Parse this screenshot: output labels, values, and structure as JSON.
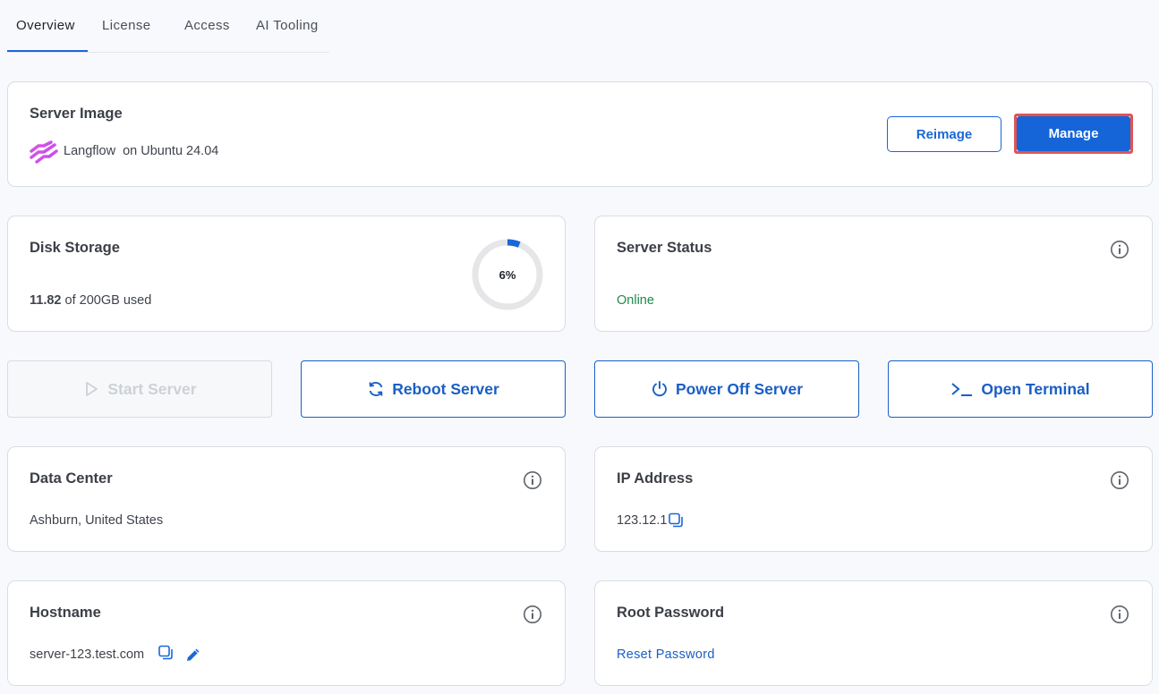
{
  "tabs": [
    {
      "label": "Overview",
      "active": true
    },
    {
      "label": "License",
      "active": false
    },
    {
      "label": "Access",
      "active": false
    },
    {
      "label": "AI Tooling",
      "active": false
    }
  ],
  "server_image": {
    "title": "Server Image",
    "app_name": "Langflow",
    "os_text": "on Ubuntu 24.04",
    "reimage_label": "Reimage",
    "manage_label": "Manage"
  },
  "disk": {
    "title": "Disk Storage",
    "used": "11.82",
    "total_text": "of 200GB used",
    "percent_label": "6%",
    "percent_value": 6
  },
  "status": {
    "title": "Server Status",
    "value": "Online"
  },
  "actions": {
    "start": "Start Server",
    "reboot": "Reboot Server",
    "power_off": "Power Off Server",
    "terminal": "Open Terminal"
  },
  "data_center": {
    "title": "Data Center",
    "value": "Ashburn, United States"
  },
  "ip": {
    "title": "IP Address",
    "value": "123.12.1"
  },
  "hostname": {
    "title": "Hostname",
    "value": "server-123.test.com"
  },
  "root_password": {
    "title": "Root Password",
    "link": "Reset Password"
  },
  "colors": {
    "accent": "#1a67d8",
    "online": "#1f8a4c",
    "highlight": "#e15454"
  }
}
